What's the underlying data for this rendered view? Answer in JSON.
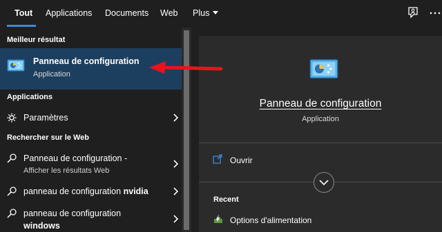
{
  "tabs": [
    {
      "label": "Tout",
      "active": true
    },
    {
      "label": "Applications",
      "active": false
    },
    {
      "label": "Documents",
      "active": false
    },
    {
      "label": "Web",
      "active": false
    },
    {
      "label": "Plus",
      "active": false,
      "has_dropdown": true
    }
  ],
  "top_icons": [
    "feedback-icon",
    "more-options-icon"
  ],
  "left": {
    "best_match_header": "Meilleur résultat",
    "best_match": {
      "title": "Panneau de configuration",
      "subtitle": "Application",
      "icon": "control-panel-icon"
    },
    "apps_header": "Applications",
    "apps": [
      {
        "label": "Paramètres",
        "icon": "settings-gear-icon"
      }
    ],
    "web_header": "Rechercher sur le Web",
    "web_results": [
      {
        "label": "Panneau de configuration -",
        "sub": "Afficher les résultats Web"
      },
      {
        "label_prefix": "panneau de configuration ",
        "label_bold": "nvidia"
      },
      {
        "label_prefix": "panneau de configuration",
        "label_bold": "windows"
      }
    ]
  },
  "right": {
    "title": "Panneau de configuration",
    "subtitle": "Application",
    "actions": [
      {
        "label": "Ouvrir",
        "icon": "open-icon"
      }
    ],
    "recent_header": "Recent",
    "recent": [
      {
        "label": "Options d'alimentation",
        "icon": "power-options-icon"
      }
    ]
  },
  "colors": {
    "background": "#1f1f1f",
    "best_match_bg": "#1d3f5f",
    "preview_bg": "#2b2b2b",
    "accent": "#3c8bd9",
    "annotation_arrow": "#e8141b"
  }
}
